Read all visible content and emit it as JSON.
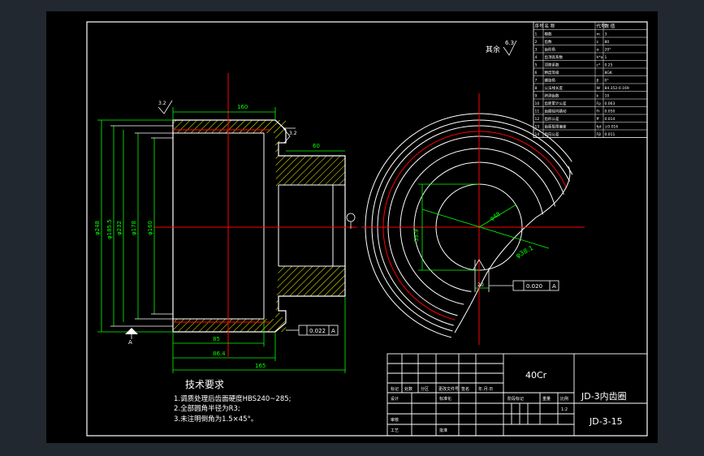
{
  "drawing": {
    "title": "JD-3内齿圈",
    "number": "JD-3-15",
    "material": "40Cr",
    "scale_text": "1:2"
  },
  "tech_requirements": {
    "heading": "技术要求",
    "items": [
      "1.调质处理后齿面硬度HBS240~285;",
      "2.全部圆角半径为R3;",
      "3.未注明倒角为1.5×45°。"
    ]
  },
  "surface_finish": {
    "label": "其余",
    "value": "6.3"
  },
  "datum": {
    "label": "A"
  },
  "tolerances": {
    "left_frame": [
      "0.022",
      "A"
    ],
    "right_frame": [
      "0.020",
      "A"
    ],
    "roughness_left": "3.2",
    "roughness_right": "3.2"
  },
  "dimensions": {
    "top_width": "160",
    "hub_width": "60",
    "bottom_1": "85",
    "bottom_2": "86.4",
    "bottom_3": "165",
    "left_1": "φ248",
    "left_2": "φ185.5",
    "left_3": "φ232",
    "left_4": "φ178",
    "left_5": "φ160",
    "bore_key": "20",
    "bore_dia": "φ38.1",
    "radial_1": "φ48",
    "bore_height": "53.9"
  },
  "param_table": {
    "header": [
      "序号",
      "名  称",
      "代号",
      "数  值"
    ],
    "rows": [
      [
        "1",
        "模数",
        "m",
        "3"
      ],
      [
        "2",
        "齿数",
        "z",
        "80"
      ],
      [
        "3",
        "齿形角",
        "α",
        "20°"
      ],
      [
        "4",
        "齿顶高系数",
        "h*a",
        "1"
      ],
      [
        "5",
        "顶隙系数",
        "c*",
        "0.25"
      ],
      [
        "6",
        "精度等级",
        "",
        "8GK"
      ],
      [
        "7",
        "螺旋角",
        "β",
        "0°"
      ],
      [
        "8",
        "公法线长度",
        "W",
        "84.352-0.169"
      ],
      [
        "9",
        "跨测齿数",
        "k",
        "10"
      ],
      [
        "10",
        "齿距累计公差",
        "Fp",
        "0.063"
      ],
      [
        "11",
        "齿圈径向跳动",
        "Fr",
        "0.050"
      ],
      [
        "12",
        "齿形公差",
        "ff",
        "0.014"
      ],
      [
        "13",
        "齿距极限偏差",
        "fpt",
        "±0.016"
      ],
      [
        "14",
        "齿向公差",
        "Fβ",
        "0.011"
      ]
    ]
  },
  "title_block": {
    "row_labels": [
      "标记",
      "处数",
      "分区",
      "更改文件号",
      "签名",
      "年.月.日"
    ],
    "design": "设计",
    "standardize": "标准化",
    "review": "审核",
    "process": "工艺",
    "approve": "批准",
    "stage_mark": "阶段标记",
    "weight": "重量",
    "scale": "比例"
  },
  "colors": {
    "line": "#ffffff",
    "centerline": "#ff0000",
    "dimension": "#00ff00",
    "hatch": "#ffff00",
    "leader": "#00ffff",
    "sheet": "#000000",
    "background": "#212830"
  }
}
